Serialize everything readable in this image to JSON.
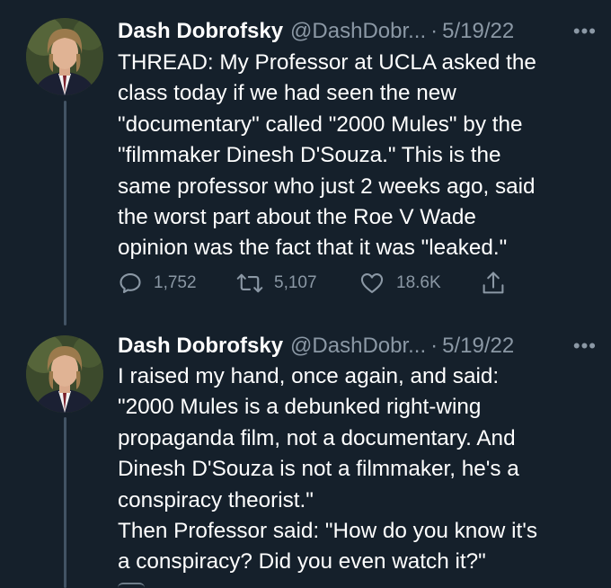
{
  "tweets": [
    {
      "author_name": "Dash Dobrofsky",
      "handle": "@DashDobr...",
      "separator": "·",
      "date": "5/19/22",
      "more": "•••",
      "text": "THREAD: My Professor at UCLA asked the\nclass today if we had seen the new\n\"documentary\" called \"2000 Mules\" by the\n\"filmmaker Dinesh D'Souza.\" This is the\nsame professor who just 2 weeks ago, said\nthe worst part about the Roe V Wade\nopinion was the fact that it was \"leaked.\"",
      "replies": "1,752",
      "retweets": "5,107",
      "likes": "18.6K"
    },
    {
      "author_name": "Dash Dobrofsky",
      "handle": "@DashDobr...",
      "separator": "·",
      "date": "5/19/22",
      "more": "•••",
      "text": "I raised my hand, once again, and said:\n\"2000 Mules is a debunked right-wing\npropaganda film, not a documentary. And\nDinesh D'Souza is not a filmmaker, he's a\nconspiracy theorist.\"\nThen Professor said: \"How do you know it's\na conspiracy? Did you even watch it?\""
    }
  ],
  "icons": {
    "reply": "reply-icon",
    "retweet": "retweet-icon",
    "like": "heart-icon",
    "share": "share-icon",
    "more": "more-icon"
  },
  "colors": {
    "background": "#15202b",
    "text": "#ffffff",
    "secondary": "#8b98a5",
    "thread_line": "#425364"
  }
}
